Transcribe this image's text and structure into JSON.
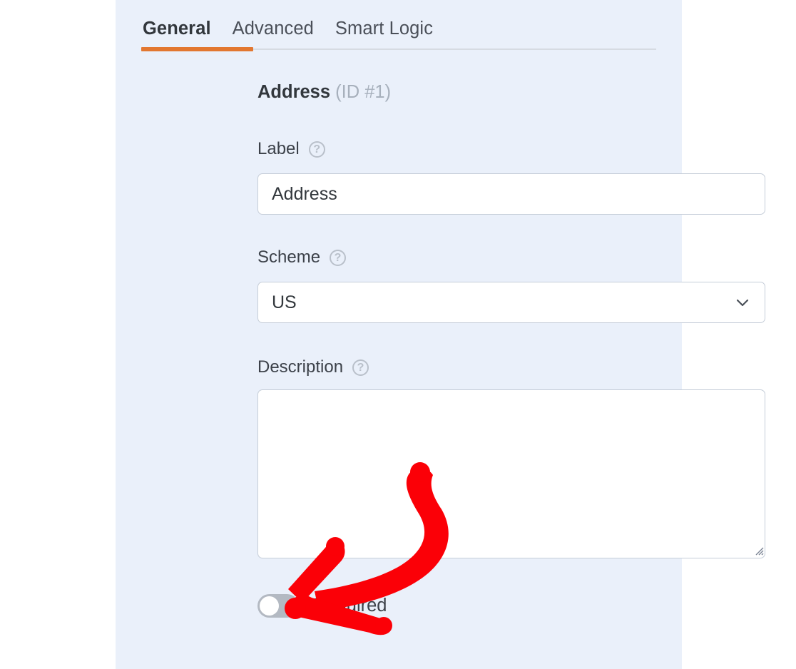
{
  "panel": {
    "background_color": "#eaf0fa"
  },
  "tabs": {
    "items": [
      {
        "label": "General",
        "active": true
      },
      {
        "label": "Advanced",
        "active": false
      },
      {
        "label": "Smart Logic",
        "active": false
      }
    ],
    "active_indicator_color": "#e27730"
  },
  "field": {
    "title_name": "Address",
    "title_id": "(ID #1)"
  },
  "label_field": {
    "label": "Label",
    "help_glyph": "?",
    "value": "Address",
    "placeholder": ""
  },
  "scheme_field": {
    "label": "Scheme",
    "help_glyph": "?",
    "value": "US",
    "options": [
      "US"
    ]
  },
  "description_field": {
    "label": "Description",
    "help_glyph": "?",
    "value": "",
    "placeholder": ""
  },
  "required_toggle": {
    "label": "Required",
    "state": "off"
  },
  "annotation": {
    "type": "curved-arrow",
    "color": "#fb0007",
    "points_to": "required-toggle"
  }
}
